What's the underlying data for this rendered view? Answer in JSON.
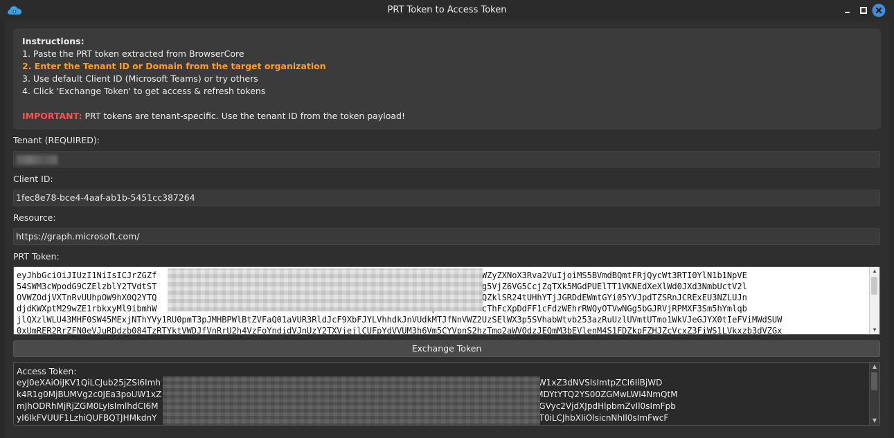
{
  "window": {
    "title": "PRT Token to Access Token"
  },
  "instructions": {
    "heading": "Instructions:",
    "steps": [
      "1. Paste the PRT token extracted from BrowserCore",
      "2. Enter the Tenant ID or Domain from the target organization",
      "3. Use default Client ID (Microsoft Teams) or try others",
      "4. Click 'Exchange Token' to get access & refresh tokens"
    ],
    "important_label": "IMPORTANT:",
    "important_text": " PRT tokens are tenant-specific. Use the tenant ID from the token payload!"
  },
  "form": {
    "tenant_label": "Tenant (REQUIRED):",
    "tenant_value": "",
    "client_id_label": "Client ID:",
    "client_id_value": "1fec8e78-bce4-4aaf-ab1b-5451cc387264",
    "resource_label": "Resource:",
    "resource_value": "https://graph.microsoft.com/",
    "prt_label": "PRT Token:",
    "prt_lines": [
      "eyJhbGciOiJIUzI1NiIsICJrZGZf                                                SVnE0MHEifQ.eyJyZWZyZXNoX3Rva2VuIjoiMS5BVmdBQmtFRjQycWt3RTI0YlN1b1NpVE",
      "54SWM3cWpodG9CZElzblY2TVdtST                                                0pyZ1hiNXpZZnRZNWg5VjZ6VG5CcjZqTXk5MGdPUElTT1VKNEdXeXlWd0JXd3NmbUctV2l",
      "OVWZOdjVXTnRvUUhpOW9hX0Q2YTQ                                                NvLWNNTzUzdlBQaEVQZklSR24tUHhYTjJGRDdEWmtGYi05YVJpdTZSRnJCRExEU3NZLUJn",
      "djdKWXptM29wZE1rbkxyMl9ibmhW                                                XYWlkOWpWWks2aG5NcThFcXpDdFF1cFdzWEhrRWQyOTVwNGg5bGJRVjRPMXF3Sm5hYmlqb",
      "jlQXzlWLU43MHF0SW45MExjNThYVy1RU0pmT3pJMHBPWlBtZVFaQ01aVUR3RldJcF9XbFJYLVhhdkJnVUdkMTJfNnVWZ2UzSElWX3p5SVhabWtvb253azRuUzlUVmtUTmo1WkVJeGJYX0tIeFViMWdSUW",
      "0xUmRER2RrZFN0eVJuRDdzb084TzRTYktVWDJfVnRrU2h4VzFoYndidVJnUzY2TXVjejlCUFpYdVVUM3h6Vm5CYVpnS2hzTmo2aWVOdzJEQmM3bEVlenM4S1FDZkpFZHJZcVcxZ3FiWS1LVkxzb3dVZGx"
    ],
    "exchange_button": "Exchange Token",
    "access_label": "Access Token:",
    "access_lines": [
      "eyJ0eXAiOiJKV1QiLCJub25jZSI6Imh                                                                I1NiIsIng1dCI6IlBjWDk4R1g0MjBUMVg2c0JEa3poUW1xZ3dNVSIsImtpZCI6IlBjWD",
      "k4R1g0MjBUMVg2c0JEa3poUW1xZ                                                                     HM6Ly9zdHMud2luZG93cy5uZXQvZTMwNTQxMDYtYTQ2YS00ZGMwLWI4NmQtM",
      "mJhODRhMjRjZGM0LyIsImlhdCI6M                                                                    AsImFjciI6IjEiLCJhY3JzIjpbInVybjp1c2VyOnJlZ2lzdGVyc2VjdXJpdHlpbmZvIl0sImFpb",
      "yI6IkFVUUF1LzhiQUFBQTJHMkdnY                                                                    dW5PUVNrU1VrSm8vMlM2UzBlWVMvSytSMnZ3PT0iLCJhbXIiOlsicnNhIl0sImFwcF"
    ]
  }
}
